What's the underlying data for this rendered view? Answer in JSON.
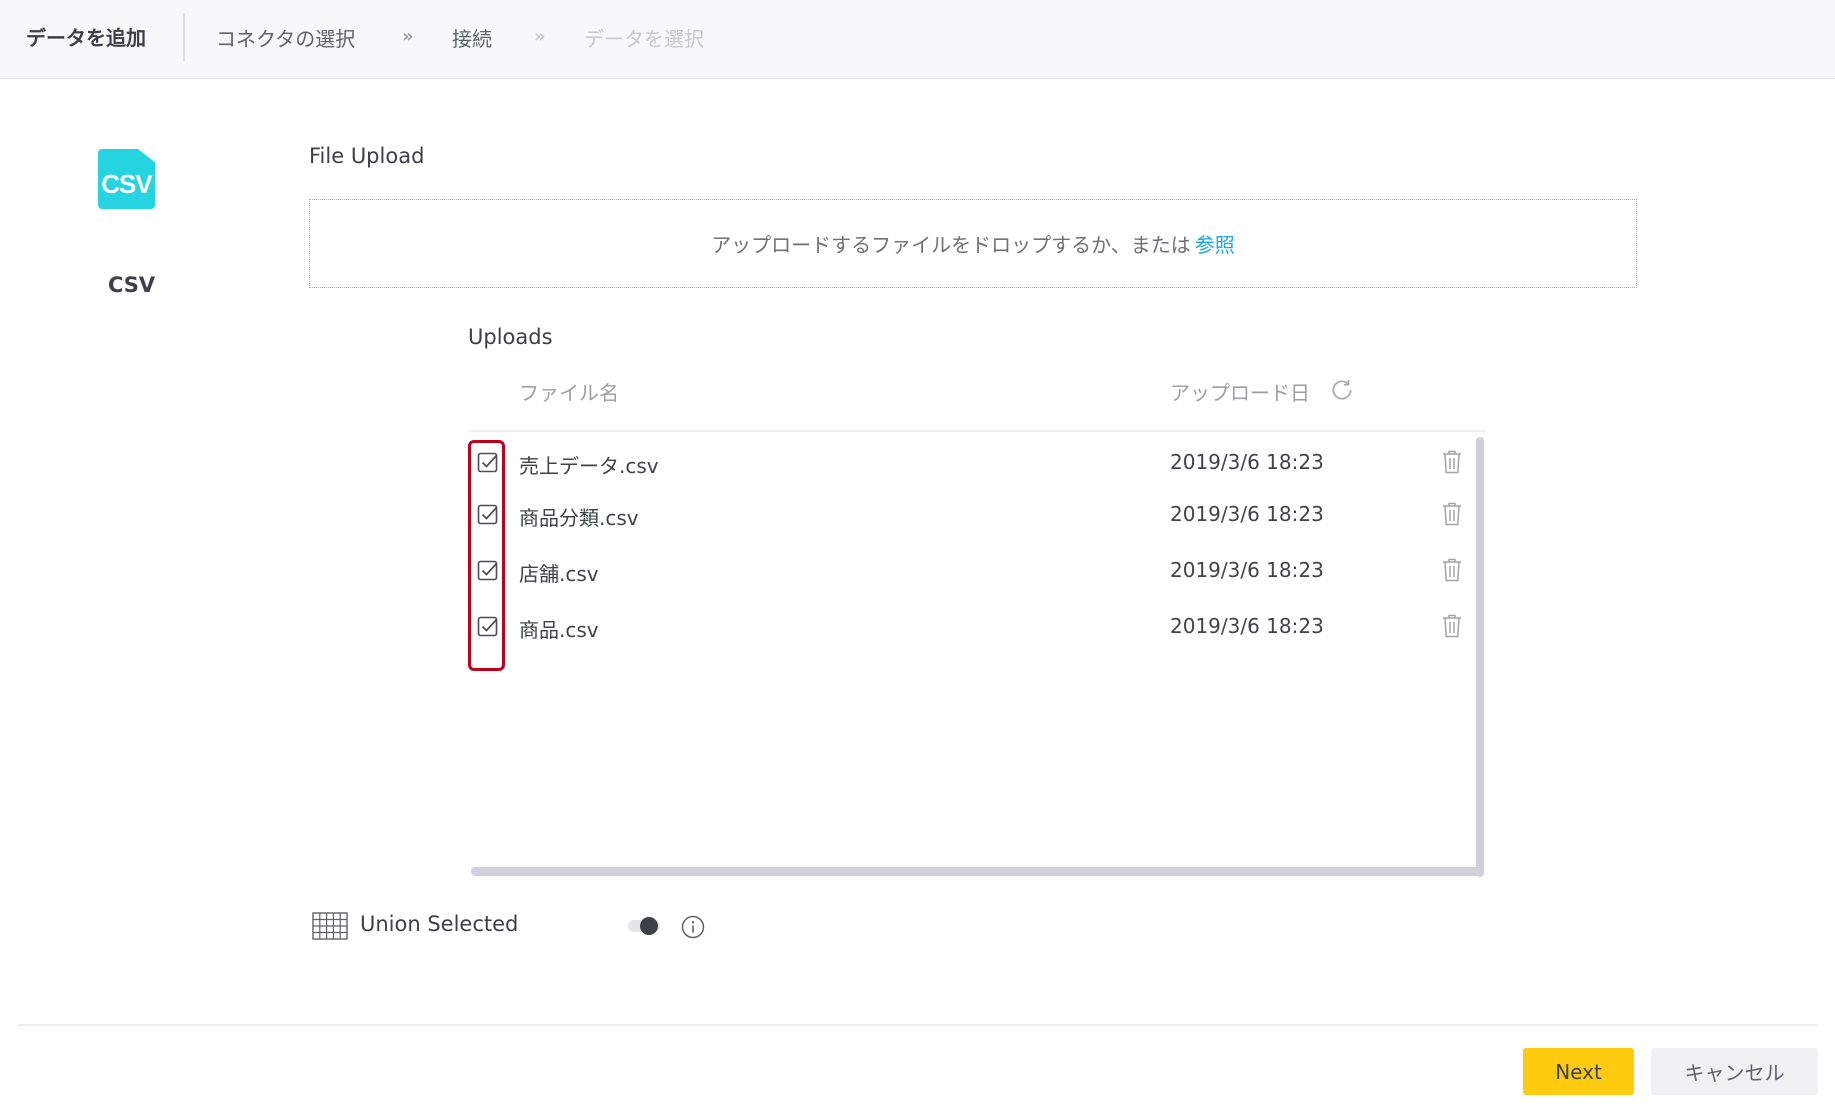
{
  "header": {
    "title": "データを追加",
    "steps": [
      {
        "label": "コネクタの選択",
        "state": "done"
      },
      {
        "label": "接続",
        "state": "current"
      },
      {
        "label": "データを選択",
        "state": "disabled"
      }
    ],
    "separator": "»"
  },
  "connector": {
    "logo_text": "CSV",
    "name": "CSV",
    "logo_color": "#26d3e0"
  },
  "file_upload": {
    "label": "File Upload",
    "drop_text": "アップロードするファイルをドロップするか、または",
    "browse_link": "参照",
    "link_color": "#1ea7e1"
  },
  "uploads": {
    "label": "Uploads",
    "columns": {
      "file_name": "ファイル名",
      "upload_date": "アップロード日"
    },
    "refresh_icon": "refresh-icon",
    "rows": [
      {
        "name": "売上データ.csv",
        "date": "2019/3/6 18:23",
        "checked": true
      },
      {
        "name": "商品分類.csv",
        "date": "2019/3/6 18:23",
        "checked": true
      },
      {
        "name": "店舗.csv",
        "date": "2019/3/6 18:23",
        "checked": true
      },
      {
        "name": "商品.csv",
        "date": "2019/3/6 18:23",
        "checked": true
      }
    ],
    "highlight_color": "#c0001a"
  },
  "union": {
    "label": "Union Selected",
    "toggle_on": false,
    "icon": "grid-icon",
    "info_icon": "info-icon"
  },
  "footer": {
    "next_label": "Next",
    "cancel_label": "キャンセル",
    "next_color": "#ffcb0f"
  }
}
